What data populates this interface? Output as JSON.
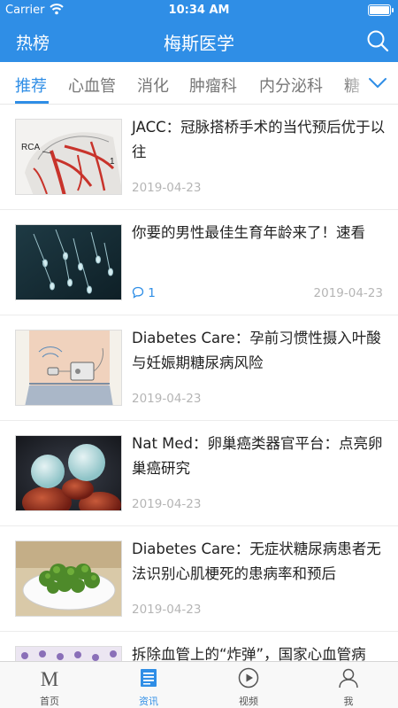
{
  "status": {
    "carrier": "Carrier",
    "time": "10:34 AM"
  },
  "nav": {
    "left": "热榜",
    "title": "梅斯医学"
  },
  "tabs": [
    {
      "label": "推荐",
      "active": true
    },
    {
      "label": "心血管"
    },
    {
      "label": "消化"
    },
    {
      "label": "肿瘤科"
    },
    {
      "label": "内分泌科"
    },
    {
      "label": "糖"
    }
  ],
  "articles": [
    {
      "title": "JACC：冠脉搭桥手术的当代预后优于以往",
      "date": "2019-04-23",
      "thumb_text": "RCA"
    },
    {
      "title": "你要的男性最佳生育年龄来了！速看",
      "date": "2019-04-23",
      "comments": "1"
    },
    {
      "title": "Diabetes Care：孕前习惯性摄入叶酸与妊娠期糖尿病风险",
      "date": "2019-04-23"
    },
    {
      "title": "Nat Med：卵巢癌类器官平台：点亮卵巢癌研究",
      "date": "2019-04-23"
    },
    {
      "title": "Diabetes Care：无症状糖尿病患者无法识别心肌梗死的患病率和预后",
      "date": "2019-04-23"
    },
    {
      "title": "拆除血管上的“炸弹”，国家心血管病",
      "date": ""
    }
  ],
  "tabbar": [
    {
      "label": "首页",
      "icon": "m-logo-icon"
    },
    {
      "label": "资讯",
      "icon": "news-icon",
      "active": true
    },
    {
      "label": "视频",
      "icon": "play-icon"
    },
    {
      "label": "我",
      "icon": "user-icon"
    }
  ],
  "colors": {
    "accent": "#2f8ee6",
    "date": "#b5b5b5"
  }
}
